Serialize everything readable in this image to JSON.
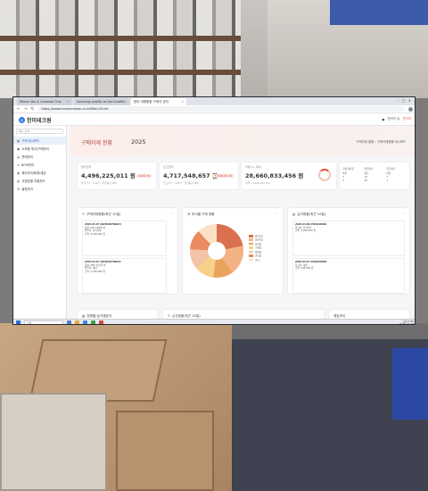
{
  "browser": {
    "tabs": [
      {
        "label": "Mimer law & Licensed Tran",
        "active": false
      },
      {
        "label": "Sourcing quality as the blueflo",
        "active": false
      },
      {
        "label": "한미 여행통합 구매자 관리",
        "active": true
      }
    ],
    "url": "https://www.hanmimenan.co.kr/Main/Chart"
  },
  "app": {
    "logo": "한미테크원",
    "user_role": "관리자",
    "user_name": "관리자 님"
  },
  "sidebar": {
    "search_placeholder": "메뉴 검색",
    "items": [
      {
        "label": "구매 대시보드",
        "active": true
      },
      {
        "label": "소모품 재고/구매관리",
        "active": false
      },
      {
        "label": "판매관리",
        "active": false
      },
      {
        "label": "BOM관리",
        "active": false
      },
      {
        "label": "재무관리/회계/세금",
        "active": false
      },
      {
        "label": "사업장별 지점관리",
        "active": false
      },
      {
        "label": "설정관리",
        "active": false
      }
    ]
  },
  "page": {
    "title": "구매자재 현황",
    "year": "2025",
    "breadcrumb": "구매자재 통합 › 구매자재현황 대시보드"
  },
  "stats": [
    {
      "label": "발주금액",
      "value": "4,496,225,011 원",
      "pct": "-4.41 %",
      "sub": "발주건수 · 132건 · 전년동기 대비"
    },
    {
      "label": "입고금액",
      "value": "4,717,548,657 원",
      "pct": "+104.51 %",
      "sub": "입고건수 · 128건 · 전년동기 대비"
    },
    {
      "label": "미결 no. 총액",
      "value": "28,660,833,456 원",
      "pct": "",
      "sub": "미결 · 4,496,225,011"
    }
  ],
  "mini_stats": [
    "구매 대분류",
    "발주대기",
    "입고대기",
    "미결",
    "완료",
    "반품",
    "3",
    "12",
    "7",
    "4",
    "28",
    "1"
  ],
  "panels": {
    "orders_title": "구매자재현황(최근 10일)",
    "pie_title": "부서별 구매 현황",
    "receipts_title": "입고현황(최근 10일)",
    "bottom": [
      "업체별 상거래분석",
      "수주현황(최근 10일)",
      "재입추이"
    ]
  },
  "orders": [
    {
      "line1": "2025.04.07  2025040700023",
      "line2": "품명: PVC HOSE 외",
      "line3": "발주처: 한미자재",
      "line4": "금액: 3,240,000 원"
    },
    {
      "line1": "2025.04.07  2025040700021",
      "line2": "품명: SMC 실린더 외",
      "line3": "발주처: 대성",
      "line4": "금액: 1,180,000 원"
    }
  ],
  "receipts": [
    {
      "line1": "2025.04.08  2504018001",
      "line2": "입고처: 한미테크",
      "line3": "금액: 3,200,000 원"
    },
    {
      "line1": "2025.04.07  2504018002",
      "line2": "입고처: 대성",
      "line3": "금액: 235,000 원"
    }
  ],
  "legend": [
    "생산1팀",
    "생산2팀",
    "품질팀",
    "구매팀",
    "영업팀",
    "관리팀",
    "기타"
  ],
  "taskbar": {
    "search": "검색",
    "time": "오후 7:30",
    "date": "2025-04-08"
  }
}
